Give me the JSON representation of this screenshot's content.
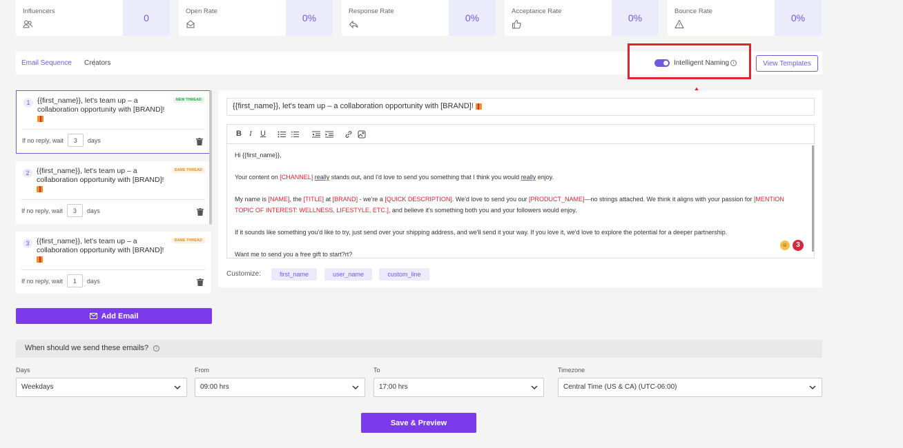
{
  "stats": [
    {
      "label": "Influencers",
      "value": "0",
      "icon": "users-icon"
    },
    {
      "label": "Open Rate",
      "value": "0%",
      "icon": "envelope-open-icon"
    },
    {
      "label": "Response Rate",
      "value": "0%",
      "icon": "reply-icon"
    },
    {
      "label": "Acceptance Rate",
      "value": "0%",
      "icon": "thumbs-up-icon"
    },
    {
      "label": "Bounce Rate",
      "value": "0%",
      "icon": "warning-icon"
    }
  ],
  "tabs": {
    "email_sequence": "Email Sequence",
    "creators": "Creators"
  },
  "intelligent_naming": {
    "label": "Intelligent Naming",
    "enabled": true
  },
  "view_templates": "View Templates",
  "emails": [
    {
      "number": "1",
      "subject": "{{first_name}}, let's team up – a collaboration opportunity with [BRAND]!",
      "badge": "NEW THREAD",
      "wait_prefix": "If no reply, wait",
      "wait_days": "3",
      "wait_suffix": "days"
    },
    {
      "number": "2",
      "subject": "{{first_name}}, let's team up – a collaboration opportunity with [BRAND]!",
      "badge": "SAME THREAD",
      "wait_prefix": "If no reply, wait",
      "wait_days": "3",
      "wait_suffix": "days"
    },
    {
      "number": "3",
      "subject": "{{first_name}}, let's team up – a collaboration opportunity with [BRAND]!",
      "badge": "SAME THREAD",
      "wait_prefix": "If no reply, wait",
      "wait_days": "1",
      "wait_suffix": "days"
    }
  ],
  "editor": {
    "subject": "{{first_name}}, let's team up – a collaboration opportunity with [BRAND]!",
    "greeting": "Hi {{first_name}},",
    "p1": {
      "a": "Your content on ",
      "channel": "[CHANNEL]",
      "b": " ",
      "really1": "really",
      "c": " stands out, and I'd love to send you something that I think you would ",
      "really2": "really",
      "d": " enjoy."
    },
    "p2": {
      "a": "My name is ",
      "name": "[NAME]",
      "b": ", the ",
      "title": "[TITLE]",
      "c": " at ",
      "brand": "[BRAND]",
      "d": " - we're a ",
      "desc": "[QUICK DESCRIPTION]",
      "e": ". We'd love to send you our ",
      "product": "[PRODUCT_NAME]",
      "f": "—no strings attached. We think it aligns with your passion for ",
      "topic": "[MENTION TOPIC OF INTEREST: WELLNESS, LIFESTYLE, ETC.]",
      "g": ", and believe it's something both you and your followers would enjoy."
    },
    "p3": "If it sounds like something you'd like to try, just send over your shipping address, and we'll send it your way. If you love it, we'd love to explore the potential for a deeper partnership.",
    "p4": "Want me to send you a free gift to start?rt?",
    "badge_count": "3"
  },
  "customize": {
    "label": "Customize:",
    "chips": [
      "first_name",
      "user_name",
      "custom_line"
    ]
  },
  "add_email": "Add Email",
  "schedule": {
    "question": "When should we send these emails?",
    "days_label": "Days",
    "days_value": "Weekdays",
    "from_label": "From",
    "from_value": "09:00 hrs",
    "to_label": "To",
    "to_value": "17:00 hrs",
    "timezone_label": "Timezone",
    "timezone_value": "Central Time (US & CA) (UTC-06:00)"
  },
  "save_preview": "Save & Preview"
}
